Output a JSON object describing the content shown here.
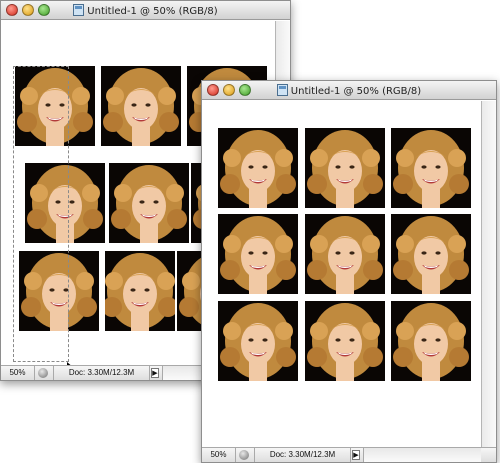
{
  "windows": [
    {
      "title": "Untitled-1 @ 50% (RGB/8)",
      "zoom": "50%",
      "doc_size": "Doc: 3.30M/12.3M"
    },
    {
      "title": "Untitled-1 @ 50% (RGB/8)",
      "zoom": "50%",
      "doc_size": "Doc: 3.30M/12.3M"
    }
  ],
  "colors": {
    "photo_background": "#0a0604",
    "hair": "#c08a3e",
    "skin": "#f1c9a5"
  },
  "icons": [
    "document-icon",
    "close-light",
    "minimize-light",
    "zoom-light",
    "status-menu-icon",
    "status-arrow-icon",
    "move-cursor-icon"
  ]
}
